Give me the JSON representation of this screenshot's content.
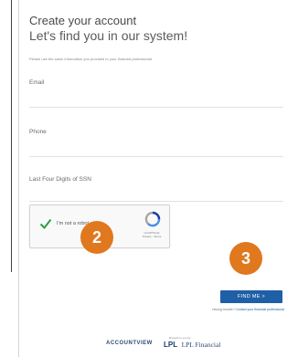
{
  "form": {
    "title": "Create your account",
    "subtitle": "Let's find you in our system!",
    "notice": "Please use the same information you provided to your financial professional.",
    "email_label": "Email",
    "phone_label": "Phone",
    "ssn_label": "Last Four Digits of SSN"
  },
  "captcha": {
    "label": "I'm not a robot",
    "brand": "reCAPTCHA",
    "links": "Privacy - Terms",
    "icon": "recaptcha-icon",
    "checked": true
  },
  "steps": {
    "captcha_step": "2",
    "submit_step": "3",
    "badge_color": "#e0781e"
  },
  "actions": {
    "find_me_label": "FIND ME",
    "find_me_arrow": ">",
    "help_prefix": "Having trouble?",
    "help_link": "Contact your financial professional",
    "button_color": "#1f5fa6"
  },
  "footer": {
    "accountview_logo": "ACCOUNTVIEW",
    "lpl_prefix": "Brought to you by",
    "lpl_mark": "LPL",
    "lpl_text": "LPL Financial"
  }
}
